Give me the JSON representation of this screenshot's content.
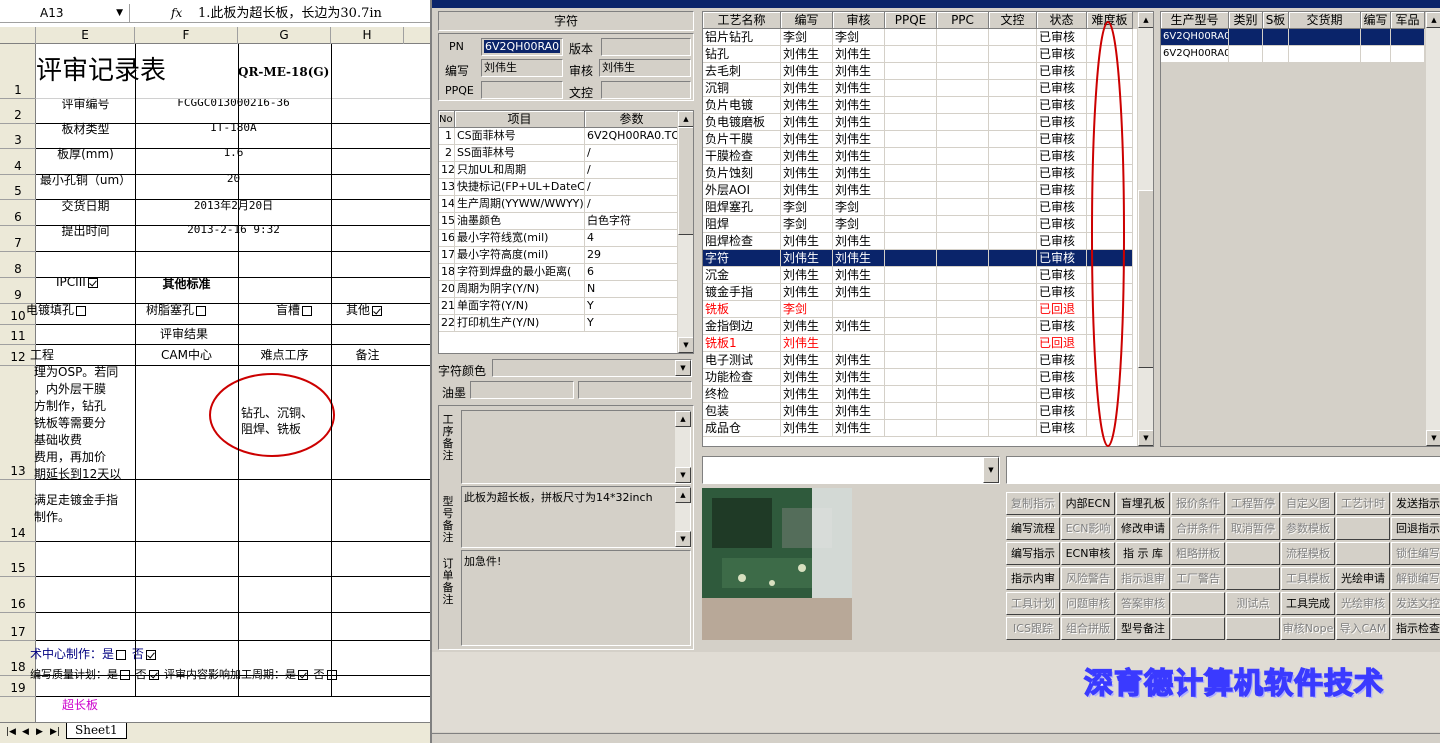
{
  "excel": {
    "name_box": "A13",
    "formula_icon": "fx",
    "formula_value": "1.此板为超长板，长边为30.7in",
    "columns": [
      "E",
      "F",
      "G",
      "H"
    ],
    "rows": [
      "1",
      "2",
      "3",
      "4",
      "5",
      "6",
      "7",
      "8",
      "9",
      "10",
      "11",
      "12",
      "13",
      "14",
      "15",
      "16",
      "17",
      "18",
      "19"
    ],
    "title": "评审记录表",
    "form_code": "QR-ME-18(G)",
    "fields": [
      {
        "label": "评审编号",
        "value": "FCGGC013000216-36"
      },
      {
        "label": "板材类型",
        "value": "IT-180A"
      },
      {
        "label": "板厚(mm)",
        "value": "1.6"
      },
      {
        "label": "最小孔铜（um）",
        "value": "20"
      },
      {
        "label": "交货日期",
        "value": "2013年2月20日"
      },
      {
        "label": "提出时间",
        "value": "2013-2-16  9:32"
      }
    ],
    "ipc_label": "IPCIII",
    "other_std": "其他标准",
    "r10": {
      "a": "电镀填孔",
      "b": "树脂塞孔",
      "c": "盲槽",
      "d": "其他"
    },
    "review_result": "评审结果",
    "r12": {
      "e": "工程",
      "f": "CAM中心",
      "g": "难点工序",
      "h": "备注"
    },
    "r13_lines": [
      "理为OSP。若同",
      "，内外层干膜",
      "方制作，钻孔",
      "铣板等需要分",
      "基础收费",
      "费用，再加价",
      "期延长到12天以"
    ],
    "r13_g_lines": [
      "钻孔、沉铜、",
      "阻焊、铣板"
    ],
    "r14_lines": [
      "满足走镀金手指",
      "制作。"
    ],
    "r18a": {
      "label": "术中心制作：是",
      "no": "否"
    },
    "r18b": {
      "label": "编写质量计划：是",
      "no": "否",
      "label2": "评审内容影响加工周期：是",
      "no2": "否"
    },
    "r19": "超长板",
    "sheet_tab": "Sheet1"
  },
  "app": {
    "section_title": "字符",
    "pn_label": "PN",
    "pn_value": "6V2QH00RA0",
    "version_label": "版本",
    "version_value": "",
    "author_label": "编写",
    "author_value": "刘伟生",
    "reviewer_label": "审核",
    "reviewer_value": "刘伟生",
    "ppqe_label": "PPQE",
    "ppqe_value": "",
    "doc_label": "文控",
    "doc_value": "",
    "params_headers": [
      "No",
      "项目",
      "参数"
    ],
    "params": [
      {
        "no": "1",
        "item": "CS面菲林号",
        "value": "6V2QH00RA0.TO"
      },
      {
        "no": "2",
        "item": "SS面菲林号",
        "value": "/"
      },
      {
        "no": "12",
        "item": "只加UL和周期",
        "value": "/"
      },
      {
        "no": "13",
        "item": "快捷标记(FP+UL+DateCo",
        "value": "/"
      },
      {
        "no": "14",
        "item": "生产周期(YYWW/WWYY)",
        "value": "/"
      },
      {
        "no": "15",
        "item": "油墨颜色",
        "value": "白色字符"
      },
      {
        "no": "16",
        "item": "最小字符线宽(mil)",
        "value": "4"
      },
      {
        "no": "17",
        "item": "最小字符高度(mil)",
        "value": "29"
      },
      {
        "no": "18",
        "item": "字符到焊盘的最小距离(",
        "value": "6"
      },
      {
        "no": "20",
        "item": "周期为阴字(Y/N)",
        "value": "N"
      },
      {
        "no": "21",
        "item": "单面字符(Y/N)",
        "value": "Y"
      },
      {
        "no": "22",
        "item": "打印机生产(Y/N)",
        "value": "Y"
      }
    ],
    "char_color_label": "字符颜色",
    "ink_label": "油墨",
    "process_note_label": "工序备注",
    "model_note_label": "型号备注",
    "model_note": "此板为超长板，拼板尺寸为14*32inch",
    "order_note_label": "订单备注",
    "order_note": "加急件!",
    "process_headers": [
      "工艺名称",
      "编写",
      "审核",
      "PPQE",
      "PPC",
      "文控",
      "状态",
      "难度板"
    ],
    "process_rows": [
      {
        "name": "铝片钻孔",
        "author": "李剑",
        "reviewer": "李剑",
        "status": "已审核"
      },
      {
        "name": "钻孔",
        "author": "刘伟生",
        "reviewer": "刘伟生",
        "status": "已审核"
      },
      {
        "name": "去毛刺",
        "author": "刘伟生",
        "reviewer": "刘伟生",
        "status": "已审核"
      },
      {
        "name": "沉铜",
        "author": "刘伟生",
        "reviewer": "刘伟生",
        "status": "已审核"
      },
      {
        "name": "负片电镀",
        "author": "刘伟生",
        "reviewer": "刘伟生",
        "status": "已审核"
      },
      {
        "name": "负电镀磨板",
        "author": "刘伟生",
        "reviewer": "刘伟生",
        "status": "已审核"
      },
      {
        "name": "负片干膜",
        "author": "刘伟生",
        "reviewer": "刘伟生",
        "status": "已审核"
      },
      {
        "name": "干膜检查",
        "author": "刘伟生",
        "reviewer": "刘伟生",
        "status": "已审核"
      },
      {
        "name": "负片蚀刻",
        "author": "刘伟生",
        "reviewer": "刘伟生",
        "status": "已审核"
      },
      {
        "name": "外层AOI",
        "author": "刘伟生",
        "reviewer": "刘伟生",
        "status": "已审核"
      },
      {
        "name": "阻焊塞孔",
        "author": "李剑",
        "reviewer": "李剑",
        "status": "已审核"
      },
      {
        "name": "阻焊",
        "author": "李剑",
        "reviewer": "李剑",
        "status": "已审核"
      },
      {
        "name": "阻焊检查",
        "author": "刘伟生",
        "reviewer": "刘伟生",
        "status": "已审核"
      },
      {
        "name": "字符",
        "author": "刘伟生",
        "reviewer": "刘伟生",
        "status": "已审核",
        "selected": true
      },
      {
        "name": "沉金",
        "author": "刘伟生",
        "reviewer": "刘伟生",
        "status": "已审核"
      },
      {
        "name": "镀金手指",
        "author": "刘伟生",
        "reviewer": "刘伟生",
        "status": "已审核"
      },
      {
        "name": "铣板",
        "author": "李剑",
        "reviewer": "",
        "status": "已回退",
        "red": true
      },
      {
        "name": "金指倒边",
        "author": "刘伟生",
        "reviewer": "刘伟生",
        "status": "已审核"
      },
      {
        "name": "铣板1",
        "author": "刘伟生",
        "reviewer": "",
        "status": "已回退",
        "red": true
      },
      {
        "name": "电子测试",
        "author": "刘伟生",
        "reviewer": "刘伟生",
        "status": "已审核"
      },
      {
        "name": "功能检查",
        "author": "刘伟生",
        "reviewer": "刘伟生",
        "status": "已审核"
      },
      {
        "name": "终检",
        "author": "刘伟生",
        "reviewer": "刘伟生",
        "status": "已审核"
      },
      {
        "name": "包装",
        "author": "刘伟生",
        "reviewer": "刘伟生",
        "status": "已审核"
      },
      {
        "name": "成品仓",
        "author": "刘伟生",
        "reviewer": "刘伟生",
        "status": "已审核"
      }
    ],
    "model_headers": [
      "生产型号",
      "类别",
      "S板",
      "交货期",
      "编写",
      "军品"
    ],
    "model_rows": [
      {
        "model": "6V2QH00RA0",
        "selected": true
      },
      {
        "model": "6V2QH00RA0",
        "selected": false
      }
    ],
    "buttons": [
      {
        "label": "复制指示",
        "enabled": false
      },
      {
        "label": "内部ECN",
        "enabled": true
      },
      {
        "label": "盲埋孔板",
        "enabled": true
      },
      {
        "label": "报价条件",
        "enabled": false
      },
      {
        "label": "工程暂停",
        "enabled": false
      },
      {
        "label": "自定义图",
        "enabled": false
      },
      {
        "label": "工艺计时",
        "enabled": false
      },
      {
        "label": "发送指示",
        "enabled": true
      },
      {
        "label": "编写流程",
        "enabled": true
      },
      {
        "label": "ECN影响",
        "enabled": false
      },
      {
        "label": "修改申请",
        "enabled": true
      },
      {
        "label": "合拼条件",
        "enabled": false
      },
      {
        "label": "取消暂停",
        "enabled": false
      },
      {
        "label": "参数模板",
        "enabled": false
      },
      {
        "label": "",
        "enabled": false
      },
      {
        "label": "回退指示",
        "enabled": true
      },
      {
        "label": "编写指示",
        "enabled": true
      },
      {
        "label": "ECN审核",
        "enabled": true
      },
      {
        "label": "指 示 库",
        "enabled": true
      },
      {
        "label": "粗略拼板",
        "enabled": false
      },
      {
        "label": "",
        "enabled": false
      },
      {
        "label": "流程模板",
        "enabled": false
      },
      {
        "label": "",
        "enabled": false
      },
      {
        "label": "锁住编写",
        "enabled": false
      },
      {
        "label": "指示内审",
        "enabled": true
      },
      {
        "label": "风险警告",
        "enabled": false
      },
      {
        "label": "指示退审",
        "enabled": false
      },
      {
        "label": "工厂警告",
        "enabled": false
      },
      {
        "label": "",
        "enabled": false
      },
      {
        "label": "工具模板",
        "enabled": false
      },
      {
        "label": "光绘申请",
        "enabled": true
      },
      {
        "label": "解锁编写",
        "enabled": false
      },
      {
        "label": "工具计划",
        "enabled": false
      },
      {
        "label": "问题审核",
        "enabled": false
      },
      {
        "label": "答案审核",
        "enabled": false
      },
      {
        "label": "",
        "enabled": false
      },
      {
        "label": "测试点",
        "enabled": false
      },
      {
        "label": "工具完成",
        "enabled": true
      },
      {
        "label": "光绘审核",
        "enabled": false
      },
      {
        "label": "发送文控",
        "enabled": false
      },
      {
        "label": "ICS跟踪",
        "enabled": false
      },
      {
        "label": "组合拼版",
        "enabled": false
      },
      {
        "label": "型号备注",
        "enabled": true
      },
      {
        "label": "",
        "enabled": false
      },
      {
        "label": "",
        "enabled": false
      },
      {
        "label": "审核Nope",
        "enabled": false
      },
      {
        "label": "导入CAM",
        "enabled": false
      },
      {
        "label": "指示检查",
        "enabled": true
      }
    ],
    "banner": "深育德计算机软件技术",
    "colors": {
      "selection": "#0a246a",
      "annotation": "#cc0000",
      "rollback": "#ff0000",
      "banner": "#3a3aff"
    }
  }
}
